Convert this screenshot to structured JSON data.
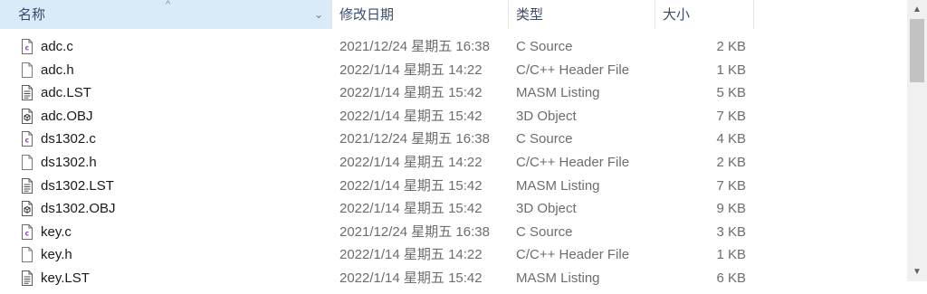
{
  "header": {
    "name_label": "名称",
    "date_label": "修改日期",
    "type_label": "类型",
    "size_label": "大小",
    "sort_glyph": "^",
    "chevron_glyph": "⌄"
  },
  "files": [
    {
      "name": "adc.c",
      "date": "2021/12/24 星期五 16:38",
      "type": "C Source",
      "size": "2 KB",
      "icon": "c-source-icon"
    },
    {
      "name": "adc.h",
      "date": "2022/1/14 星期五 14:22",
      "type": "C/C++ Header File",
      "size": "1 KB",
      "icon": "header-file-icon"
    },
    {
      "name": "adc.LST",
      "date": "2022/1/14 星期五 15:42",
      "type": "MASM Listing",
      "size": "5 KB",
      "icon": "listing-file-icon"
    },
    {
      "name": "adc.OBJ",
      "date": "2022/1/14 星期五 15:42",
      "type": "3D Object",
      "size": "7 KB",
      "icon": "3d-object-icon"
    },
    {
      "name": "ds1302.c",
      "date": "2021/12/24 星期五 16:38",
      "type": "C Source",
      "size": "4 KB",
      "icon": "c-source-icon"
    },
    {
      "name": "ds1302.h",
      "date": "2022/1/14 星期五 14:22",
      "type": "C/C++ Header File",
      "size": "2 KB",
      "icon": "header-file-icon"
    },
    {
      "name": "ds1302.LST",
      "date": "2022/1/14 星期五 15:42",
      "type": "MASM Listing",
      "size": "7 KB",
      "icon": "listing-file-icon"
    },
    {
      "name": "ds1302.OBJ",
      "date": "2022/1/14 星期五 15:42",
      "type": "3D Object",
      "size": "9 KB",
      "icon": "3d-object-icon"
    },
    {
      "name": "key.c",
      "date": "2021/12/24 星期五 16:38",
      "type": "C Source",
      "size": "3 KB",
      "icon": "c-source-icon"
    },
    {
      "name": "key.h",
      "date": "2022/1/14 星期五 14:22",
      "type": "C/C++ Header File",
      "size": "1 KB",
      "icon": "header-file-icon"
    },
    {
      "name": "key.LST",
      "date": "2022/1/14 星期五 15:42",
      "type": "MASM Listing",
      "size": "6 KB",
      "icon": "listing-file-icon"
    }
  ],
  "scrollbar": {
    "up_glyph": "▲",
    "down_glyph": "▼",
    "scroll_fraction": 0.0
  },
  "colors": {
    "header_selected": "#d9ebf9",
    "c_icon_accent": "#8a3fbf",
    "secondary_text": "#6d6d6d"
  }
}
